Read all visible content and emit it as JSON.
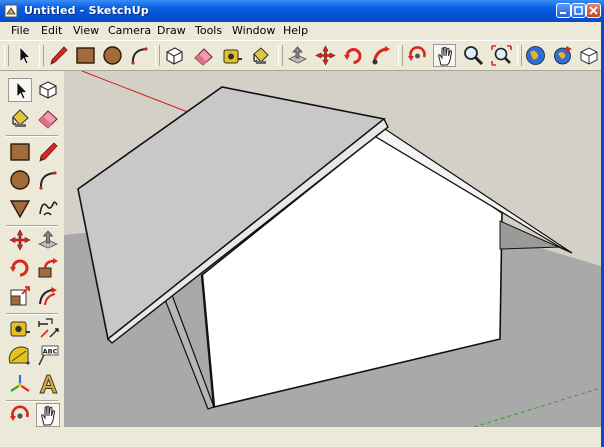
{
  "window": {
    "title": "Untitled - SketchUp",
    "minimize_label": "",
    "maximize_label": "",
    "close_label": ""
  },
  "menubar": {
    "items": [
      "File",
      "Edit",
      "View",
      "Camera",
      "Draw",
      "Tools",
      "Window",
      "Help"
    ]
  },
  "top_toolbar": {
    "tools": [
      "select-icon",
      "line-icon",
      "rectangle-icon",
      "circle-icon",
      "arc-icon",
      "make-component-icon",
      "eraser-icon",
      "tape-measure-icon",
      "paint-bucket-icon",
      "push-pull-icon",
      "move-icon",
      "rotate-icon",
      "follow-me-icon",
      "orbit-icon",
      "pan-icon",
      "zoom-icon",
      "zoom-extents-icon",
      "get-models-icon",
      "share-model-icon",
      "components-icon"
    ],
    "active_tool": "pan-icon"
  },
  "left_toolbar": {
    "tools": [
      "select-icon",
      "make-component-icon",
      "paint-bucket-icon",
      "eraser-icon",
      "rectangle-icon",
      "line-icon",
      "circle-icon",
      "arc-icon",
      "polygon-icon",
      "freehand-icon",
      "move-icon",
      "push-pull-icon",
      "rotate-icon",
      "follow-me-icon",
      "scale-icon",
      "offset-icon",
      "tape-measure-icon",
      "dimension-icon",
      "protractor-icon",
      "text-icon",
      "axes-icon",
      "3d-text-icon",
      "orbit-icon",
      "pan-icon"
    ],
    "dimension_text": "ABC",
    "active_tool": "pan-icon"
  },
  "colors": {
    "sky": "#D4D0C8",
    "ground": "#A9A9A9",
    "roof": "#C8C8C8",
    "wall": "#FFFFFF",
    "red_axis": "#D22020",
    "xp_blue": "#0A5FE0"
  }
}
